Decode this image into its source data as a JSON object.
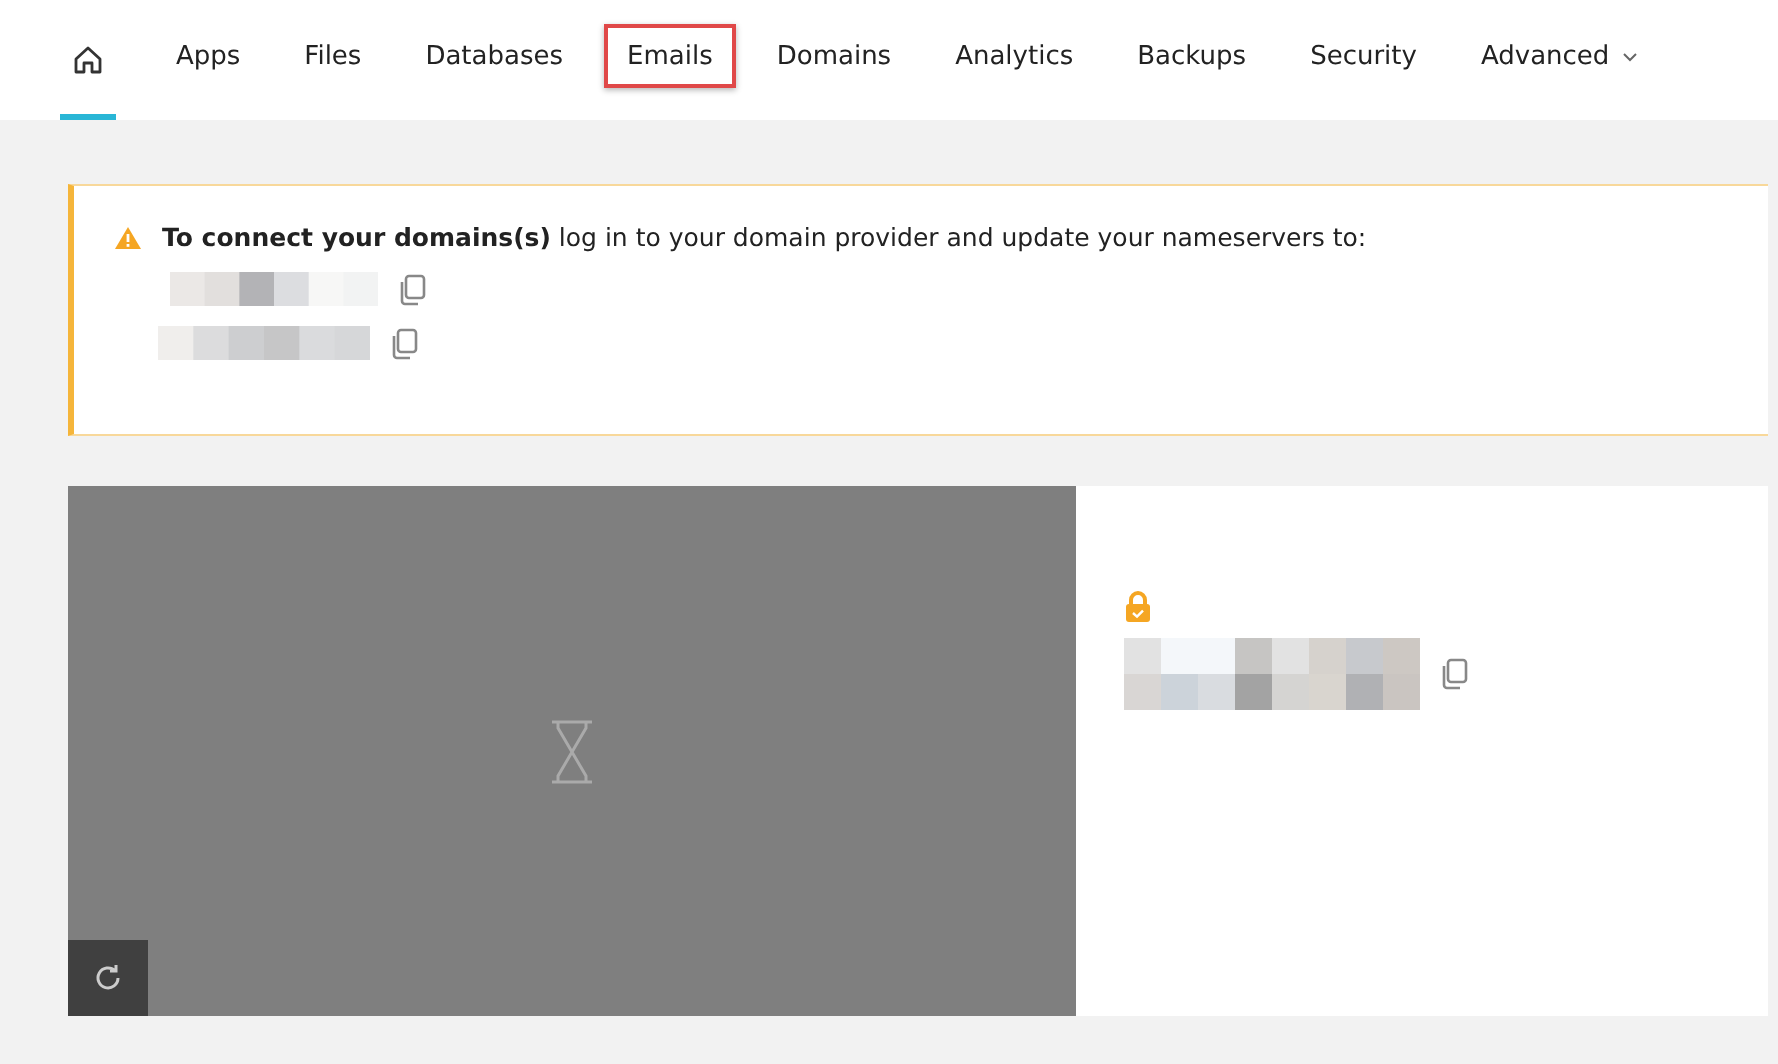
{
  "nav": {
    "home": {
      "selected": true
    },
    "tabs": [
      {
        "label": "Apps",
        "selected": false,
        "highlighted": false
      },
      {
        "label": "Files",
        "selected": false,
        "highlighted": false
      },
      {
        "label": "Databases",
        "selected": false,
        "highlighted": false
      },
      {
        "label": "Emails",
        "selected": false,
        "highlighted": true
      },
      {
        "label": "Domains",
        "selected": false,
        "highlighted": false
      },
      {
        "label": "Analytics",
        "selected": false,
        "highlighted": false
      },
      {
        "label": "Backups",
        "selected": false,
        "highlighted": false
      },
      {
        "label": "Security",
        "selected": false,
        "highlighted": false
      },
      {
        "label": "Advanced",
        "selected": false,
        "highlighted": false,
        "dropdown": true
      }
    ]
  },
  "notice": {
    "bold": "To connect your domains(s)",
    "text": " log in to your domain provider and update your nameservers to:"
  },
  "site": {
    "ssl_secure": true
  }
}
